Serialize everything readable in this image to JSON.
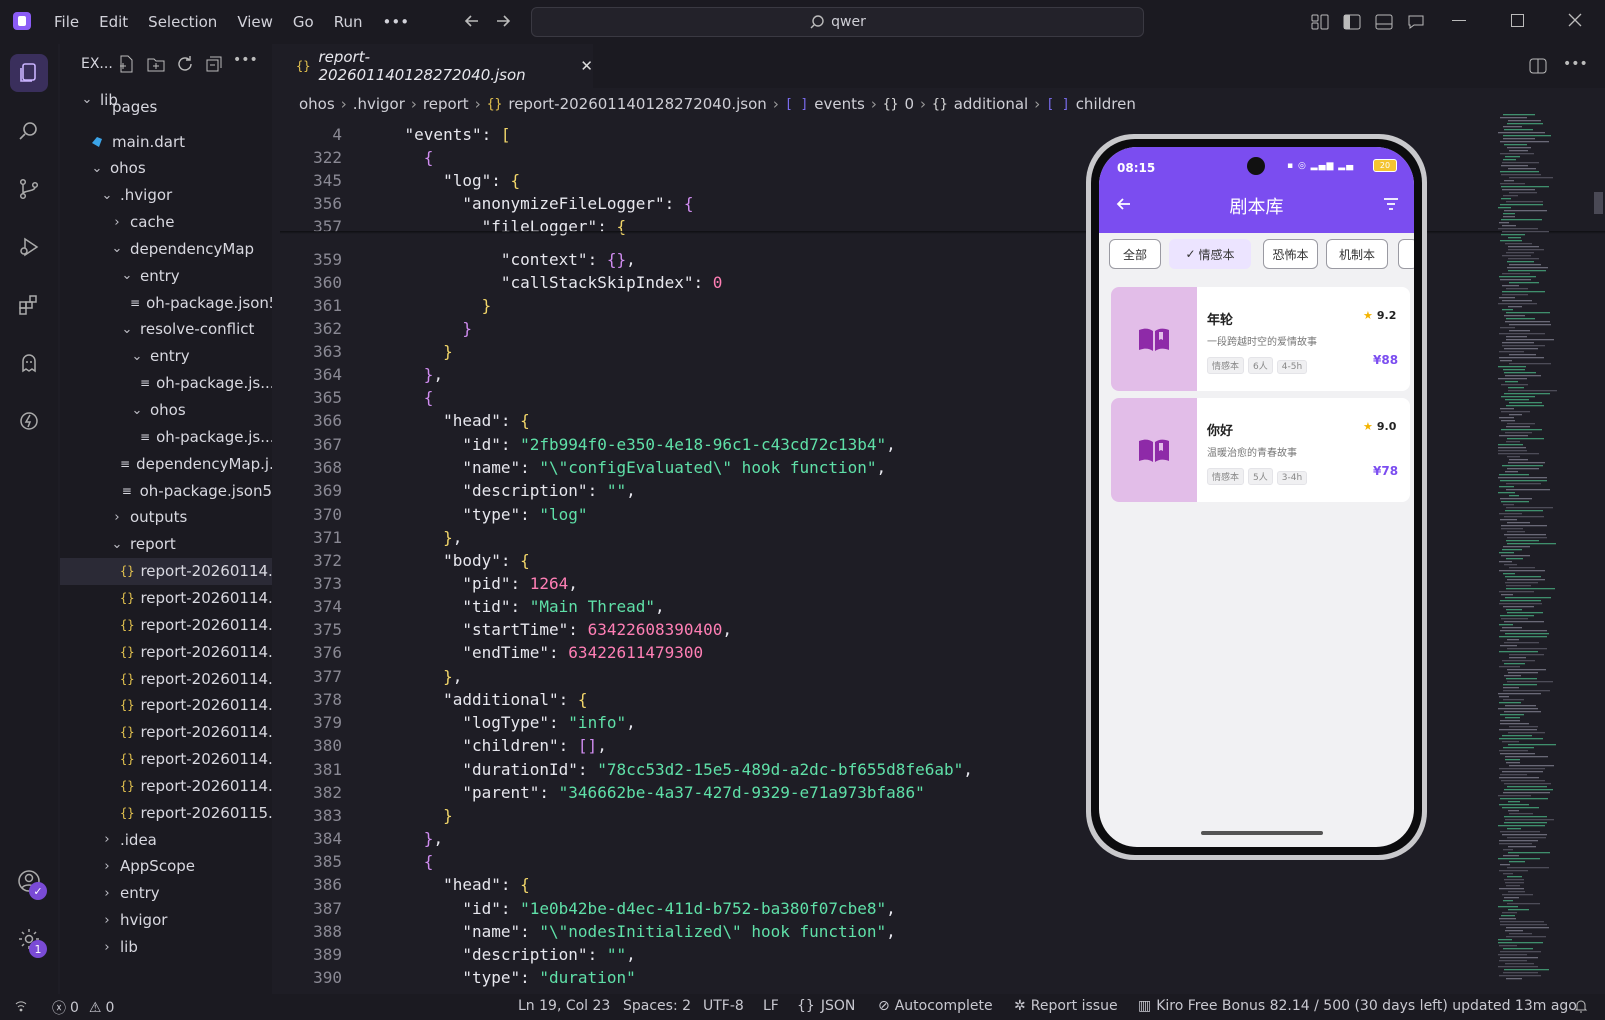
{
  "menu": [
    "File",
    "Edit",
    "Selection",
    "View",
    "Go",
    "Run",
    "•••"
  ],
  "search": {
    "text": "qwer"
  },
  "explorer": {
    "title": "EX...",
    "rows": [
      {
        "label": "lib",
        "indent": 0,
        "kind": "folder-open"
      },
      {
        "label": "pages",
        "indent": 1,
        "kind": "partial"
      },
      {
        "label": "main.dart",
        "indent": 1,
        "kind": "dart"
      },
      {
        "label": "ohos",
        "indent": 1,
        "kind": "folder-open"
      },
      {
        "label": ".hvigor",
        "indent": 2,
        "kind": "folder-open"
      },
      {
        "label": "cache",
        "indent": 3,
        "kind": "folder"
      },
      {
        "label": "dependencyMap",
        "indent": 3,
        "kind": "folder-open"
      },
      {
        "label": "entry",
        "indent": 4,
        "kind": "folder-open"
      },
      {
        "label": "oh-package.json5",
        "indent": 5,
        "kind": "file"
      },
      {
        "label": "resolve-conflict",
        "indent": 4,
        "kind": "folder-open"
      },
      {
        "label": "entry",
        "indent": 5,
        "kind": "folder-open"
      },
      {
        "label": "oh-package.js...",
        "indent": 6,
        "kind": "file"
      },
      {
        "label": "ohos",
        "indent": 5,
        "kind": "folder-open"
      },
      {
        "label": "oh-package.js...",
        "indent": 6,
        "kind": "file"
      },
      {
        "label": "dependencyMap.j...",
        "indent": 4,
        "kind": "file"
      },
      {
        "label": "oh-package.json5",
        "indent": 4,
        "kind": "file"
      },
      {
        "label": "outputs",
        "indent": 3,
        "kind": "folder"
      },
      {
        "label": "report",
        "indent": 3,
        "kind": "folder-open"
      },
      {
        "label": "report-20260114...",
        "indent": 4,
        "kind": "json",
        "selected": true
      },
      {
        "label": "report-20260114...",
        "indent": 4,
        "kind": "json"
      },
      {
        "label": "report-20260114...",
        "indent": 4,
        "kind": "json"
      },
      {
        "label": "report-20260114...",
        "indent": 4,
        "kind": "json"
      },
      {
        "label": "report-20260114...",
        "indent": 4,
        "kind": "json"
      },
      {
        "label": "report-20260114...",
        "indent": 4,
        "kind": "json"
      },
      {
        "label": "report-20260114...",
        "indent": 4,
        "kind": "json"
      },
      {
        "label": "report-20260114...",
        "indent": 4,
        "kind": "json"
      },
      {
        "label": "report-20260114...",
        "indent": 4,
        "kind": "json"
      },
      {
        "label": "report-20260115...",
        "indent": 4,
        "kind": "json"
      },
      {
        "label": ".idea",
        "indent": 2,
        "kind": "folder"
      },
      {
        "label": "AppScope",
        "indent": 2,
        "kind": "folder"
      },
      {
        "label": "entry",
        "indent": 2,
        "kind": "folder"
      },
      {
        "label": "hvigor",
        "indent": 2,
        "kind": "folder"
      },
      {
        "label": "lib",
        "indent": 2,
        "kind": "folder"
      }
    ]
  },
  "tab": {
    "label": "report-202601140128272040.json",
    "icon": "{}"
  },
  "breadcrumb": [
    "ohos",
    ".hvigor",
    "report",
    "report-202601140128272040.json",
    "events",
    "0",
    "additional",
    "children"
  ],
  "editor": {
    "lines": [
      {
        "n": "4",
        "tokens": [
          [
            "p",
            "    "
          ],
          [
            "k",
            "\"events\""
          ],
          [
            "p",
            ": "
          ],
          [
            "b",
            "["
          ]
        ]
      },
      {
        "n": "322",
        "tokens": [
          [
            "p",
            "      "
          ],
          [
            "b2",
            "{"
          ]
        ]
      },
      {
        "n": "345",
        "tokens": [
          [
            "p",
            "        "
          ],
          [
            "k",
            "\"log\""
          ],
          [
            "p",
            ": "
          ],
          [
            "b",
            "{"
          ]
        ]
      },
      {
        "n": "356",
        "tokens": [
          [
            "p",
            "          "
          ],
          [
            "k",
            "\"anonymizeFileLogger\""
          ],
          [
            "p",
            ": "
          ],
          [
            "b2",
            "{"
          ]
        ]
      },
      {
        "n": "357",
        "tokens": [
          [
            "p",
            "            "
          ],
          [
            "k",
            "\"fileLogger\""
          ],
          [
            "p",
            ": "
          ],
          [
            "b",
            "{"
          ]
        ]
      },
      {
        "n": "359",
        "tokens": [
          [
            "p",
            "              "
          ],
          [
            "k",
            "\"context\""
          ],
          [
            "p",
            ": "
          ],
          [
            "b2",
            "{}"
          ],
          [
            "p",
            ","
          ]
        ]
      },
      {
        "n": "360",
        "tokens": [
          [
            "p",
            "              "
          ],
          [
            "k",
            "\"callStackSkipIndex\""
          ],
          [
            "p",
            ": "
          ],
          [
            "n",
            "0"
          ]
        ]
      },
      {
        "n": "361",
        "tokens": [
          [
            "p",
            "            "
          ],
          [
            "b",
            "}"
          ]
        ]
      },
      {
        "n": "362",
        "tokens": [
          [
            "p",
            "          "
          ],
          [
            "b2",
            "}"
          ]
        ]
      },
      {
        "n": "363",
        "tokens": [
          [
            "p",
            "        "
          ],
          [
            "b",
            "}"
          ]
        ]
      },
      {
        "n": "364",
        "tokens": [
          [
            "p",
            "      "
          ],
          [
            "b2",
            "}"
          ],
          [
            "p",
            ","
          ]
        ]
      },
      {
        "n": "365",
        "tokens": [
          [
            "p",
            "      "
          ],
          [
            "b2",
            "{"
          ]
        ]
      },
      {
        "n": "366",
        "tokens": [
          [
            "p",
            "        "
          ],
          [
            "k",
            "\"head\""
          ],
          [
            "p",
            ": "
          ],
          [
            "b",
            "{"
          ]
        ]
      },
      {
        "n": "367",
        "tokens": [
          [
            "p",
            "          "
          ],
          [
            "k",
            "\"id\""
          ],
          [
            "p",
            ": "
          ],
          [
            "s",
            "\"2fb994f0-e350-4e18-96c1-c43cd72c13b4\""
          ],
          [
            "p",
            ","
          ]
        ]
      },
      {
        "n": "368",
        "tokens": [
          [
            "p",
            "          "
          ],
          [
            "k",
            "\"name\""
          ],
          [
            "p",
            ": "
          ],
          [
            "s",
            "\"\\\"configEvaluated\\\" hook function\""
          ],
          [
            "p",
            ","
          ]
        ]
      },
      {
        "n": "369",
        "tokens": [
          [
            "p",
            "          "
          ],
          [
            "k",
            "\"description\""
          ],
          [
            "p",
            ": "
          ],
          [
            "s",
            "\"\""
          ],
          [
            "p",
            ","
          ]
        ]
      },
      {
        "n": "370",
        "tokens": [
          [
            "p",
            "          "
          ],
          [
            "k",
            "\"type\""
          ],
          [
            "p",
            ": "
          ],
          [
            "s",
            "\"log\""
          ]
        ]
      },
      {
        "n": "371",
        "tokens": [
          [
            "p",
            "        "
          ],
          [
            "b",
            "}"
          ],
          [
            "p",
            ","
          ]
        ]
      },
      {
        "n": "372",
        "tokens": [
          [
            "p",
            "        "
          ],
          [
            "k",
            "\"body\""
          ],
          [
            "p",
            ": "
          ],
          [
            "b",
            "{"
          ]
        ]
      },
      {
        "n": "373",
        "tokens": [
          [
            "p",
            "          "
          ],
          [
            "k",
            "\"pid\""
          ],
          [
            "p",
            ": "
          ],
          [
            "n",
            "1264"
          ],
          [
            "p",
            ","
          ]
        ]
      },
      {
        "n": "374",
        "tokens": [
          [
            "p",
            "          "
          ],
          [
            "k",
            "\"tid\""
          ],
          [
            "p",
            ": "
          ],
          [
            "s",
            "\"Main Thread\""
          ],
          [
            "p",
            ","
          ]
        ]
      },
      {
        "n": "375",
        "tokens": [
          [
            "p",
            "          "
          ],
          [
            "k",
            "\"startTime\""
          ],
          [
            "p",
            ": "
          ],
          [
            "n",
            "63422608390400"
          ],
          [
            "p",
            ","
          ]
        ]
      },
      {
        "n": "376",
        "tokens": [
          [
            "p",
            "          "
          ],
          [
            "k",
            "\"endTime\""
          ],
          [
            "p",
            ": "
          ],
          [
            "n",
            "63422611479300"
          ]
        ]
      },
      {
        "n": "377",
        "tokens": [
          [
            "p",
            "        "
          ],
          [
            "b",
            "}"
          ],
          [
            "p",
            ","
          ]
        ]
      },
      {
        "n": "378",
        "tokens": [
          [
            "p",
            "        "
          ],
          [
            "k",
            "\"additional\""
          ],
          [
            "p",
            ": "
          ],
          [
            "b",
            "{"
          ]
        ]
      },
      {
        "n": "379",
        "tokens": [
          [
            "p",
            "          "
          ],
          [
            "k",
            "\"logType\""
          ],
          [
            "p",
            ": "
          ],
          [
            "s",
            "\"info\""
          ],
          [
            "p",
            ","
          ]
        ]
      },
      {
        "n": "380",
        "tokens": [
          [
            "p",
            "          "
          ],
          [
            "k",
            "\"children\""
          ],
          [
            "p",
            ": "
          ],
          [
            "b2",
            "[]"
          ],
          [
            "p",
            ","
          ]
        ]
      },
      {
        "n": "381",
        "tokens": [
          [
            "p",
            "          "
          ],
          [
            "k",
            "\"durationId\""
          ],
          [
            "p",
            ": "
          ],
          [
            "s",
            "\"78cc53d2-15e5-489d-a2dc-bf655d8fe6ab\""
          ],
          [
            "p",
            ","
          ]
        ]
      },
      {
        "n": "382",
        "tokens": [
          [
            "p",
            "          "
          ],
          [
            "k",
            "\"parent\""
          ],
          [
            "p",
            ": "
          ],
          [
            "s",
            "\"346662be-4a37-427d-9329-e71a973bfa86\""
          ]
        ]
      },
      {
        "n": "383",
        "tokens": [
          [
            "p",
            "        "
          ],
          [
            "b",
            "}"
          ]
        ]
      },
      {
        "n": "384",
        "tokens": [
          [
            "p",
            "      "
          ],
          [
            "b2",
            "}"
          ],
          [
            "p",
            ","
          ]
        ]
      },
      {
        "n": "385",
        "tokens": [
          [
            "p",
            "      "
          ],
          [
            "b2",
            "{"
          ]
        ]
      },
      {
        "n": "386",
        "tokens": [
          [
            "p",
            "        "
          ],
          [
            "k",
            "\"head\""
          ],
          [
            "p",
            ": "
          ],
          [
            "b",
            "{"
          ]
        ]
      },
      {
        "n": "387",
        "tokens": [
          [
            "p",
            "          "
          ],
          [
            "k",
            "\"id\""
          ],
          [
            "p",
            ": "
          ],
          [
            "s",
            "\"1e0b42be-d4ec-411d-b752-ba380f07cbe8\""
          ],
          [
            "p",
            ","
          ]
        ]
      },
      {
        "n": "388",
        "tokens": [
          [
            "p",
            "          "
          ],
          [
            "k",
            "\"name\""
          ],
          [
            "p",
            ": "
          ],
          [
            "s",
            "\"\\\"nodesInitialized\\\" hook function\""
          ],
          [
            "p",
            ","
          ]
        ]
      },
      {
        "n": "389",
        "tokens": [
          [
            "p",
            "          "
          ],
          [
            "k",
            "\"description\""
          ],
          [
            "p",
            ": "
          ],
          [
            "s",
            "\"\""
          ],
          [
            "p",
            ","
          ]
        ]
      },
      {
        "n": "390",
        "tokens": [
          [
            "p",
            "          "
          ],
          [
            "k",
            "\"type\""
          ],
          [
            "p",
            ": "
          ],
          [
            "s",
            "\"duration\""
          ]
        ]
      }
    ]
  },
  "phone": {
    "time": "08:15",
    "battery": "20",
    "title": "剧本库",
    "chips": [
      "全部",
      "情感本",
      "恐怖本",
      "机制本"
    ],
    "selected_chip": "情感本",
    "cards": [
      {
        "title": "年轮",
        "rating": "9.2",
        "desc": "一段跨越时空的爱情故事",
        "tags": [
          "情感本",
          "6人",
          "4-5h"
        ],
        "price": "¥88"
      },
      {
        "title": "你好",
        "rating": "9.0",
        "desc": "温暖治愈的青春故事",
        "tags": [
          "情感本",
          "5人",
          "3-4h"
        ],
        "price": "¥78"
      }
    ]
  },
  "status": {
    "errors": "0",
    "warnings": "0",
    "position": "Ln 19, Col 23",
    "spaces": "Spaces: 2",
    "encoding": "UTF-8",
    "eol": "LF",
    "language": "JSON",
    "autocomplete": "Autocomplete",
    "report": "Report issue",
    "bonus": "Kiro Free Bonus 82.14 / 500 (30 days left) updated 13m ago"
  },
  "badges": {
    "settings": "1"
  },
  "colors": {
    "accent": "#7b4df0",
    "string": "#5fe0a8",
    "number": "#ff7fb5",
    "bracket": "#f2d66a"
  }
}
